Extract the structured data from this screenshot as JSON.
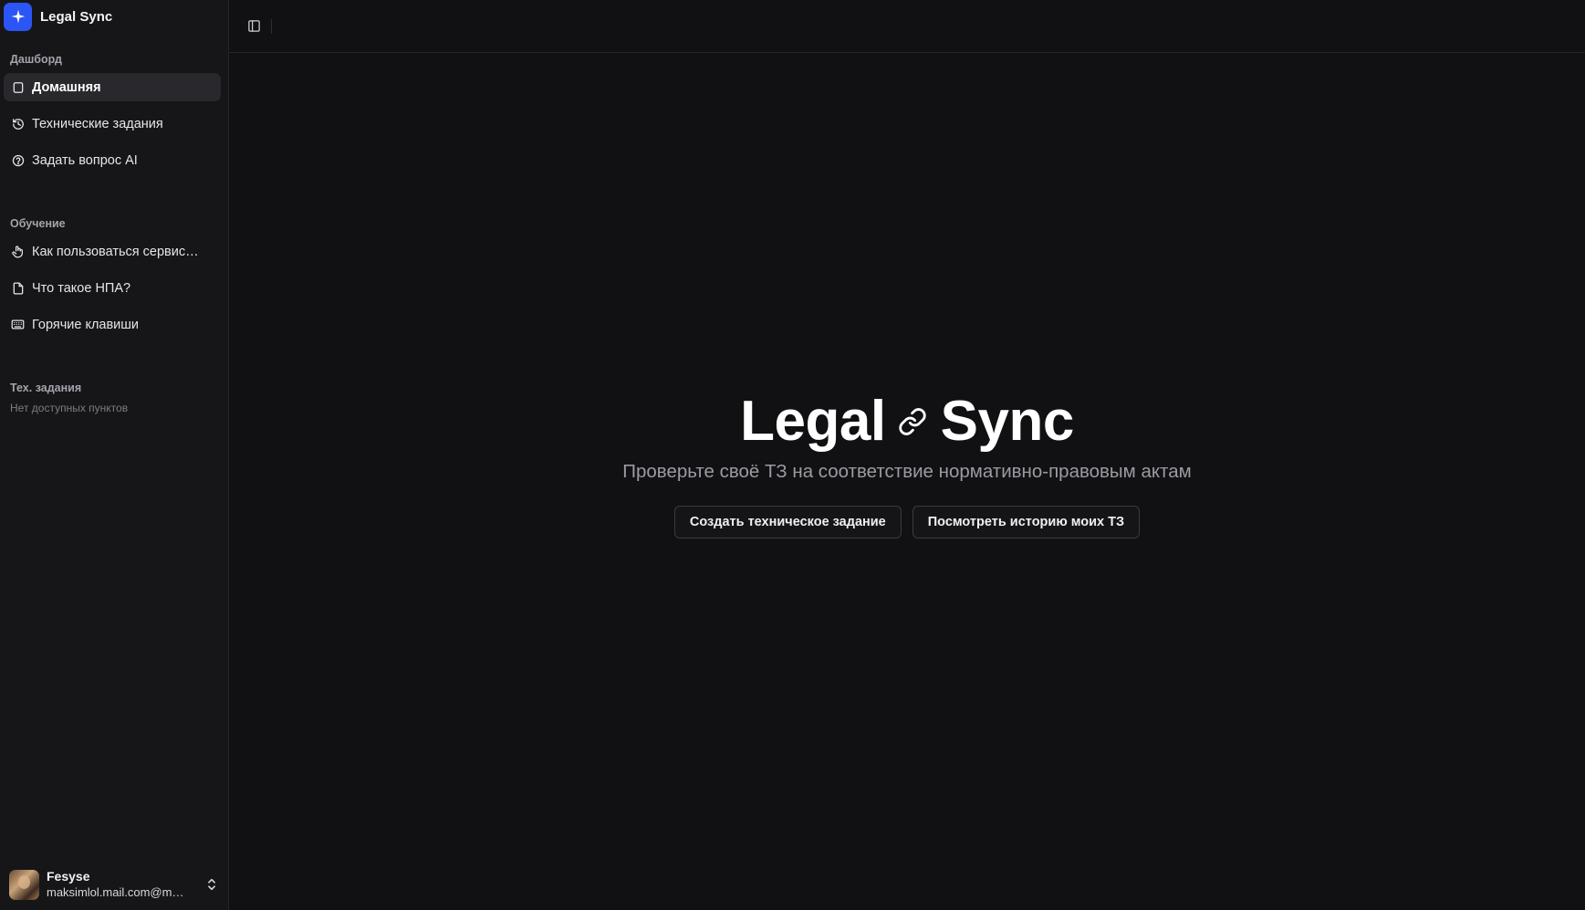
{
  "brand": {
    "name": "Legal Sync",
    "logo_icon": "sparkle-icon",
    "accent_color": "#2b55f5"
  },
  "sidebar": {
    "sections": [
      {
        "label": "Дашборд",
        "items": [
          {
            "label": "Домашняя",
            "icon": "square-icon",
            "active": true
          },
          {
            "label": "Технические задания",
            "icon": "history-icon",
            "active": false
          },
          {
            "label": "Задать вопрос AI",
            "icon": "help-circle-icon",
            "active": false
          }
        ]
      },
      {
        "label": "Обучение",
        "items": [
          {
            "label": "Как пользоваться сервис…",
            "icon": "pointer-icon",
            "active": false
          },
          {
            "label": "Что такое НПА?",
            "icon": "file-icon",
            "active": false
          },
          {
            "label": "Горячие клавиши",
            "icon": "keyboard-icon",
            "active": false
          }
        ]
      },
      {
        "label": "Тех. задания",
        "empty_note": "Нет доступных пунктов"
      }
    ]
  },
  "user": {
    "name": "Fesyse",
    "email": "maksimlol.mail.com@m…"
  },
  "topbar": {
    "toggle_icon": "sidebar-toggle-icon"
  },
  "hero": {
    "title_left": "Legal",
    "title_icon": "link-icon",
    "title_right": "Sync",
    "subtitle": "Проверьте своё ТЗ на соответствие нормативно-правовым актам",
    "primary_button": "Создать техническое задание",
    "secondary_button": "Посмотреть историю моих ТЗ"
  }
}
